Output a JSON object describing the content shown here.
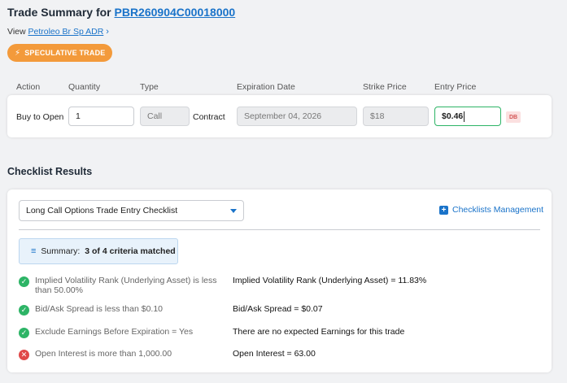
{
  "header": {
    "title_prefix": "Trade Summary for",
    "symbol": "PBR260904C00018000",
    "view_label": "View",
    "view_link": "Petroleo Br Sp ADR",
    "badge": "SPECULATIVE TRADE"
  },
  "trade": {
    "columns": [
      "Action",
      "Quantity",
      "Type",
      "Expiration Date",
      "Strike Price",
      "Entry Price"
    ],
    "action": "Buy to Open",
    "quantity": "1",
    "type": "Call",
    "unit": "Contract",
    "expiration_date": "September 04, 2026",
    "strike_price": "$18",
    "entry_price": "$0.46",
    "tag": "DB"
  },
  "checklist": {
    "section_title": "Checklist Results",
    "selected": "Long Call Options Trade Entry Checklist",
    "management_label": "Checklists Management",
    "summary_label": "Summary:",
    "summary_value": "3 of 4 criteria matched",
    "criteria": [
      {
        "label": "Implied Volatility Rank (Underlying Asset) is less than 50.00%",
        "result": "Implied Volatility Rank (Underlying Asset) = 11.83%",
        "status": "pass"
      },
      {
        "label": "Bid/Ask Spread is less than $0.10",
        "result": "Bid/Ask Spread = $0.07",
        "status": "pass"
      },
      {
        "label": "Exclude Earnings Before Expiration = Yes",
        "result": "There are no expected Earnings for this trade",
        "status": "pass"
      },
      {
        "label": "Open Interest is more than 1,000.00",
        "result": "Open Interest = 63.00",
        "status": "fail"
      }
    ]
  },
  "colors": {
    "accent": "#1a73c9",
    "badge": "#f39a3b",
    "pass": "#2db466",
    "fail": "#e04848"
  },
  "icons": {
    "badge": "lightning-icon",
    "view_link": "chevron-right-icon",
    "select": "caret-down-icon",
    "management": "plus-square-icon",
    "summary": "list-icon",
    "pass": "check-circle-icon",
    "fail": "x-circle-icon"
  }
}
